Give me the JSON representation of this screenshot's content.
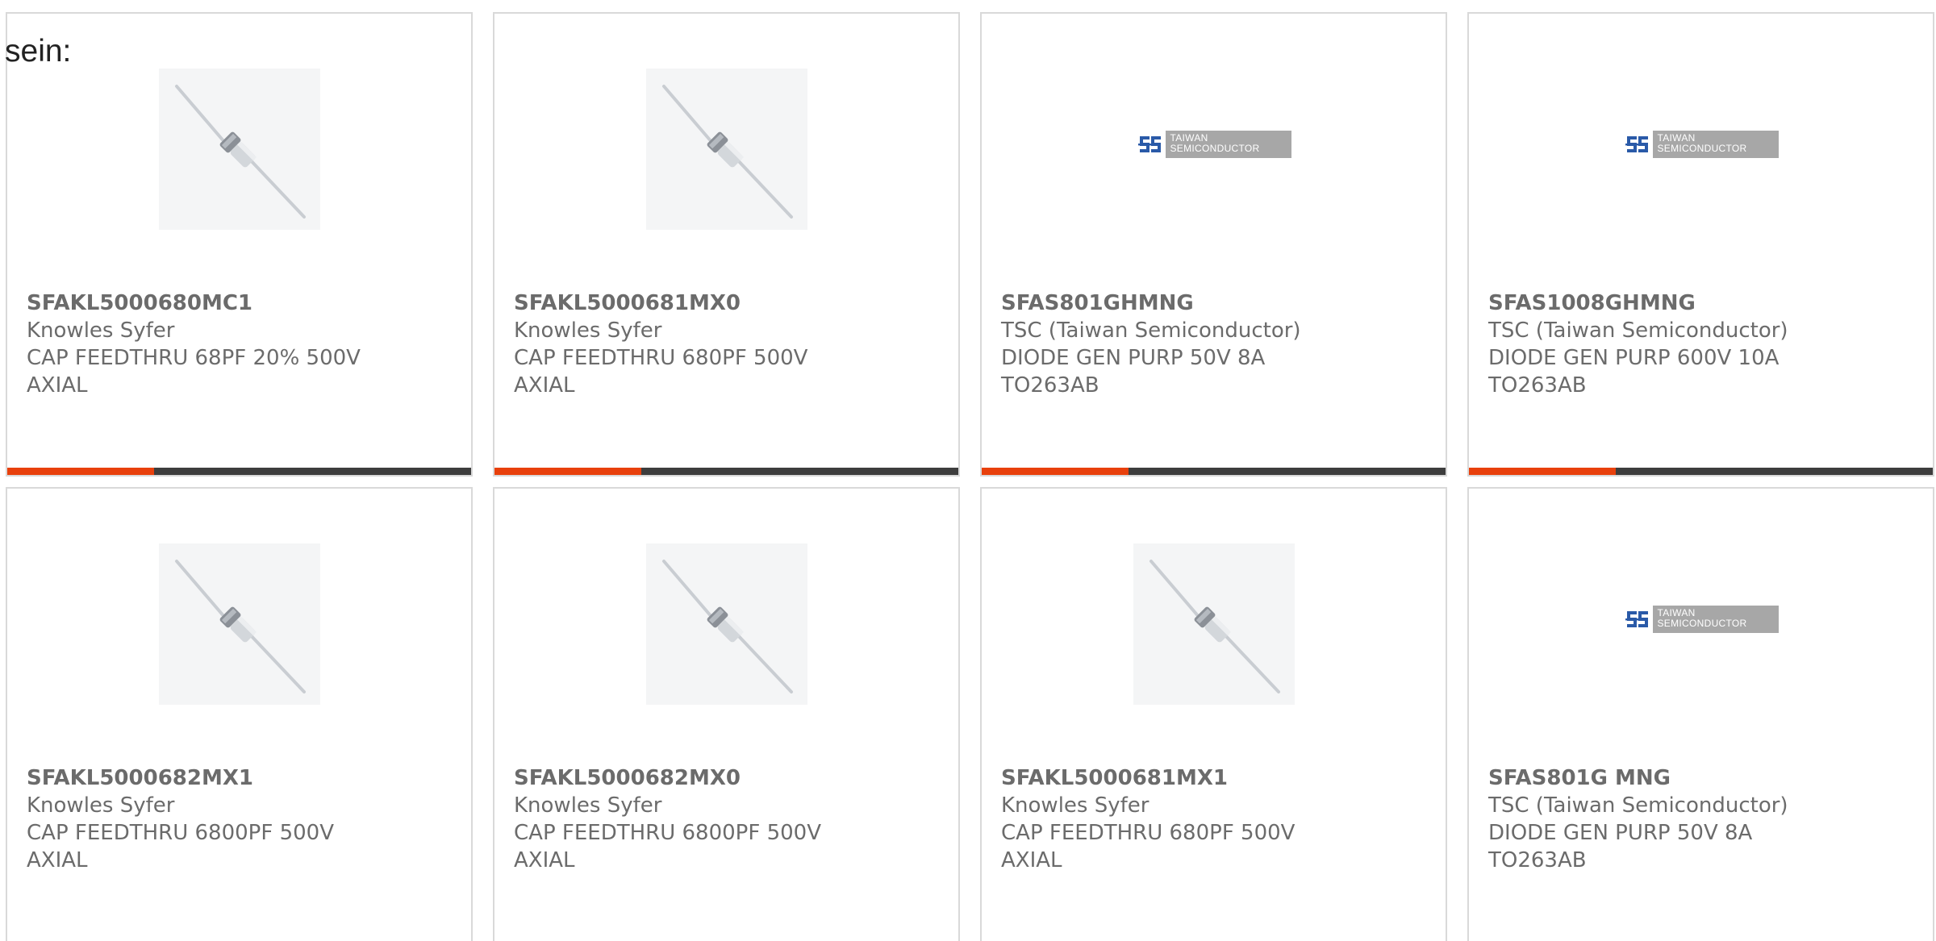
{
  "intro_text": "sein:",
  "colors": {
    "accent": "#e8400c",
    "bar": "#3d3d3d",
    "text": "#6b6b6b",
    "border": "#d9d9d9",
    "logo_gray": "#a7a7a7",
    "logo_blue": "#2a5aa8"
  },
  "logo": {
    "line1": "TAIWAN",
    "line2": "SEMICONDUCTOR"
  },
  "products": [
    {
      "image": "feedthru-capacitor-photo",
      "part_number": "SFAKL5000680MC1",
      "manufacturer": "Knowles Syfer",
      "desc_line1": "CAP FEEDTHRU 68PF 20% 500V",
      "desc_line2": "AXIAL"
    },
    {
      "image": "feedthru-capacitor-photo",
      "part_number": "SFAKL5000681MX0",
      "manufacturer": "Knowles Syfer",
      "desc_line1": "CAP FEEDTHRU 680PF 500V",
      "desc_line2": "AXIAL"
    },
    {
      "image": "tsc-logo",
      "part_number": "SFAS801GHMNG",
      "manufacturer": "TSC (Taiwan Semiconductor)",
      "desc_line1": "DIODE GEN PURP 50V 8A",
      "desc_line2": "TO263AB"
    },
    {
      "image": "tsc-logo",
      "part_number": "SFAS1008GHMNG",
      "manufacturer": "TSC (Taiwan Semiconductor)",
      "desc_line1": "DIODE GEN PURP 600V 10A",
      "desc_line2": "TO263AB"
    },
    {
      "image": "feedthru-capacitor-photo",
      "part_number": "SFAKL5000682MX1",
      "manufacturer": "Knowles Syfer",
      "desc_line1": "CAP FEEDTHRU 6800PF 500V",
      "desc_line2": "AXIAL"
    },
    {
      "image": "feedthru-capacitor-photo",
      "part_number": "SFAKL5000682MX0",
      "manufacturer": "Knowles Syfer",
      "desc_line1": "CAP FEEDTHRU 6800PF 500V",
      "desc_line2": "AXIAL"
    },
    {
      "image": "feedthru-capacitor-photo",
      "part_number": "SFAKL5000681MX1",
      "manufacturer": "Knowles Syfer",
      "desc_line1": "CAP FEEDTHRU 680PF 500V",
      "desc_line2": "AXIAL"
    },
    {
      "image": "tsc-logo",
      "part_number": "SFAS801G MNG",
      "manufacturer": "TSC (Taiwan Semiconductor)",
      "desc_line1": "DIODE GEN PURP 50V 8A",
      "desc_line2": "TO263AB"
    }
  ]
}
